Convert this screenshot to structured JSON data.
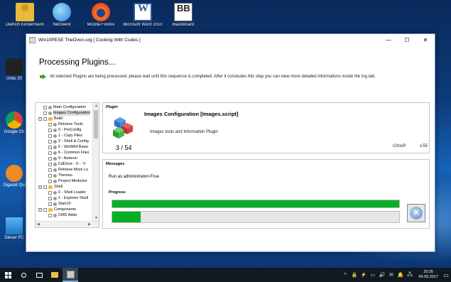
{
  "desktop": {
    "top_icons": [
      {
        "label": "Dietrich Kindermann",
        "icon": "user-folder-icon"
      },
      {
        "label": "Netzwerk",
        "icon": "network-icon"
      },
      {
        "label": "Mozilla Firefox",
        "icon": "firefox-icon"
      },
      {
        "label": "Microsoft Word 2010",
        "icon": "word-icon"
      },
      {
        "label": "BlackBoard",
        "icon": "blackboard-icon"
      }
    ],
    "side_icons": [
      {
        "label": "Untis 20",
        "icon": "untis-icon"
      },
      {
        "label": "Google Ch",
        "icon": "chrome-icon"
      },
      {
        "label": "Gigaset Qui",
        "icon": "gigaset-icon"
      },
      {
        "label": "Dieser PC",
        "icon": "computer-icon"
      }
    ],
    "word_letter": "W",
    "bb_letter": "BB"
  },
  "window": {
    "title": "Win10PESE    TheOven.org [ Cooking With Codes ]",
    "heading": "Processing Plugins...",
    "description": "All selected Plugins are being processed, please wait until this sequence is completed. After it concludes this step you can view more detailed informations inside the log tab.",
    "buttons": {
      "minimize": "—",
      "maximize": "☐",
      "close": "✕"
    }
  },
  "tree": {
    "items": [
      {
        "label": "Main Configuration",
        "kind": "gear",
        "indent": 1
      },
      {
        "label": "Images Configuration",
        "kind": "gear",
        "indent": 1,
        "selected": true
      },
      {
        "label": "Build",
        "kind": "folder",
        "indent": 0
      },
      {
        "label": "Retrieve Tools",
        "kind": "gear",
        "indent": 2
      },
      {
        "label": "0 - PreConfig",
        "kind": "gear",
        "indent": 2
      },
      {
        "label": "1 - Copy Files",
        "kind": "gear",
        "indent": 2
      },
      {
        "label": "2 - Shell & Config",
        "kind": "gear",
        "indent": 2
      },
      {
        "label": "5 - WoW64 Basic",
        "kind": "gear",
        "indent": 2
      },
      {
        "label": "6 - Common Files",
        "kind": "gear",
        "indent": 2
      },
      {
        "label": "9 - Autorun",
        "kind": "gear",
        "indent": 2
      },
      {
        "label": "CdDrive - X: - Y:",
        "kind": "gear",
        "indent": 2
      },
      {
        "label": "Retrieve More Lo",
        "kind": "gear",
        "indent": 2
      },
      {
        "label": "Themes",
        "kind": "gear",
        "indent": 2
      },
      {
        "label": "Project Medicine",
        "kind": "gear",
        "indent": 2
      },
      {
        "label": "Shell",
        "kind": "folder",
        "indent": 0
      },
      {
        "label": "0 - Shell Loader",
        "kind": "gear",
        "indent": 2
      },
      {
        "label": "1 - Explorer Shell",
        "kind": "gear",
        "indent": 2
      },
      {
        "label": "Start10",
        "kind": "gear",
        "indent": 2
      },
      {
        "label": "Components",
        "kind": "folder",
        "indent": 0
      },
      {
        "label": "CMD Adds",
        "kind": "gear",
        "indent": 2
      }
    ]
  },
  "plugin": {
    "caption": "Plugin",
    "name": "Images Configuration [Images.script]",
    "description": "Images tools and Information Plugin",
    "counter": "3 / 54",
    "author": "ChrisR",
    "version": "v.55"
  },
  "messages": {
    "caption": "Messages",
    "text": "Run as administrator=True",
    "progress_caption": "Progress",
    "progress_overall": 1.0,
    "progress_current": 0.1,
    "cancel_symbol": "✕"
  },
  "taskbar": {
    "time": "20:25",
    "date": "04.09.2017",
    "tray_icons": [
      "^",
      "🔒",
      "⚡",
      "▭",
      "🔊",
      "✉",
      "🔔",
      "🖧"
    ]
  },
  "colors": {
    "progress": "#06b025",
    "accent": "#0078d7"
  }
}
